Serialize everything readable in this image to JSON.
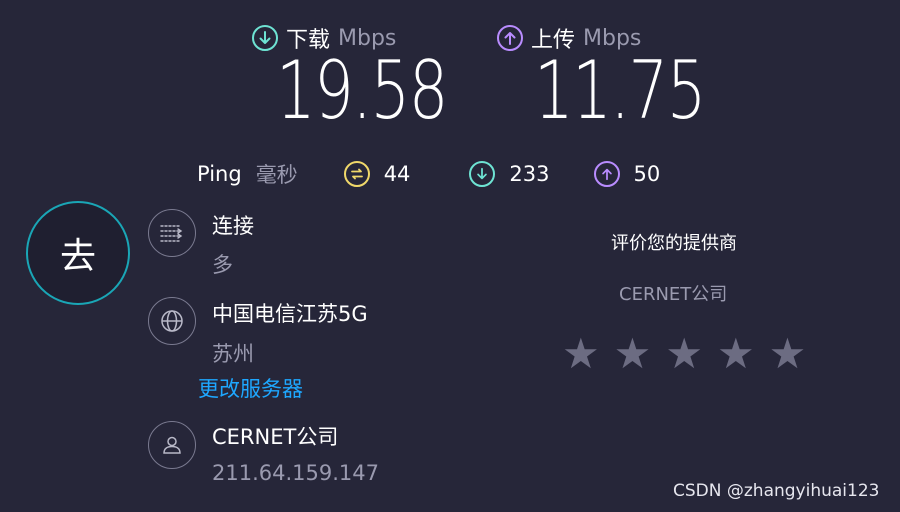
{
  "download": {
    "label": "下载",
    "unit": "Mbps",
    "value": "19.58",
    "icon": "arrow-down-circle-icon",
    "color": "#6ee3d3"
  },
  "upload": {
    "label": "上传",
    "unit": "Mbps",
    "value": "11.75",
    "icon": "arrow-up-circle-icon",
    "color": "#b98cff"
  },
  "ping": {
    "label": "Ping",
    "unit": "毫秒",
    "idle": "44",
    "idle_color": "#f0d86a",
    "download": "233",
    "download_color": "#6ee3d3",
    "upload": "50",
    "upload_color": "#b98cff"
  },
  "go_button": {
    "label": "去"
  },
  "connections": {
    "title": "连接",
    "value": "多",
    "icon": "connections-icon"
  },
  "server": {
    "name": "中国电信江苏5G",
    "location": "苏州",
    "change_link": "更改服务器",
    "icon": "globe-icon"
  },
  "provider": {
    "name": "CERNET公司",
    "ip": "211.64.159.147",
    "icon": "user-icon"
  },
  "rating": {
    "title": "评价您的提供商",
    "provider": "CERNET公司",
    "stars": 5,
    "rated": 0
  },
  "watermark": "CSDN @zhangyihuai123",
  "colors": {
    "background": "#262639",
    "link": "#1ea7ff",
    "go_ring": "#1aa6b6",
    "star": "#6c6c82"
  }
}
